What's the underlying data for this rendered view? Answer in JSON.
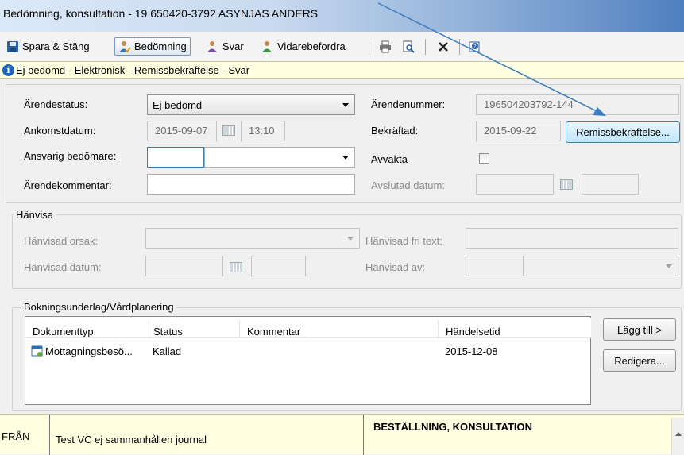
{
  "window": {
    "title": "Bedömning, konsultation  -  19 650420-3792 ASYNJAS ANDERS"
  },
  "toolbar": {
    "save_close": "Spara & Stäng",
    "assessment": "Bedömning",
    "reply": "Svar",
    "forward": "Vidarebefordra"
  },
  "infobar": {
    "text": "Ej bedömd  -  Elektronisk  -  Remissbekräftelse  -  Svar"
  },
  "case": {
    "status_label": "Ärendestatus:",
    "status_value": "Ej bedömd",
    "arrival_label": "Ankomstdatum:",
    "arrival_date": "2015-09-07",
    "arrival_time": "13:10",
    "responsible_label": "Ansvarig bedömare:",
    "comment_label": "Ärendekommentar:",
    "number_label": "Ärendenummer:",
    "number_value": "196504203792-144",
    "confirmed_label": "Bekräftad:",
    "confirmed_value": "2015-09-22",
    "confirmation_button": "Remissbekräftelse...",
    "wait_label": "Avvakta",
    "closed_label": "Avslutad datum:"
  },
  "referral": {
    "group_title": "Hänvisa",
    "reason_label": "Hänvisad orsak:",
    "date_label": "Hänvisad datum:",
    "free_text_label": "Hänvisad fri text:",
    "by_label": "Hänvisad av:"
  },
  "booking": {
    "group_title": "Bokningsunderlag/Vårdplanering",
    "columns": [
      "Dokumenttyp",
      "Status",
      "Kommentar",
      "Händelsetid"
    ],
    "rows": [
      {
        "type": "Mottagningsbesö...",
        "status": "Kallad",
        "comment": "",
        "time": "2015-12-08"
      }
    ],
    "add_button": "Lägg till >",
    "edit_button": "Redigera..."
  },
  "order": {
    "from_label": "FRÅN",
    "from_value": "Test VC ej sammanhållen journal",
    "heading": "BESTÄLLNING, KONSULTATION"
  },
  "colors": {
    "accent": "#3c7fb1",
    "info_bg": "#ffffe1",
    "arrow": "#3b7cc0"
  }
}
